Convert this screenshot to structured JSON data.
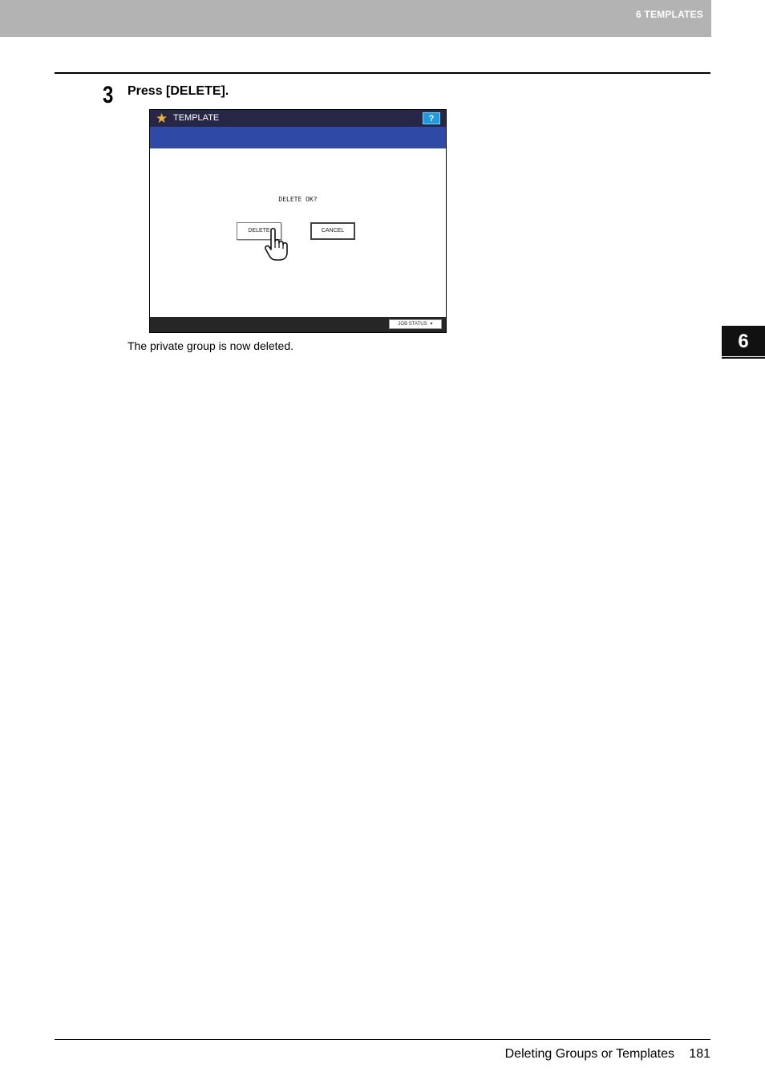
{
  "header": {
    "title": "6 TEMPLATES"
  },
  "step": {
    "number": "3",
    "instruction": "Press [DELETE]."
  },
  "screen": {
    "title": "TEMPLATE",
    "help_label": "?",
    "message": "DELETE OK?",
    "delete_label": "DELETE",
    "cancel_label": "CANCEL",
    "job_status_label": "JOB STATUS",
    "icons": [
      "star-icon",
      "hand-pointer-icon",
      "arrow-down-icon"
    ],
    "colors": {
      "titlebar": "#262646",
      "bluebar": "#2f4aa6",
      "help": "#1e9be0"
    }
  },
  "caption": "The private group is now deleted.",
  "chapter_tab": "6",
  "footer": {
    "section_title": "Deleting Groups or Templates",
    "page_number": "181"
  }
}
